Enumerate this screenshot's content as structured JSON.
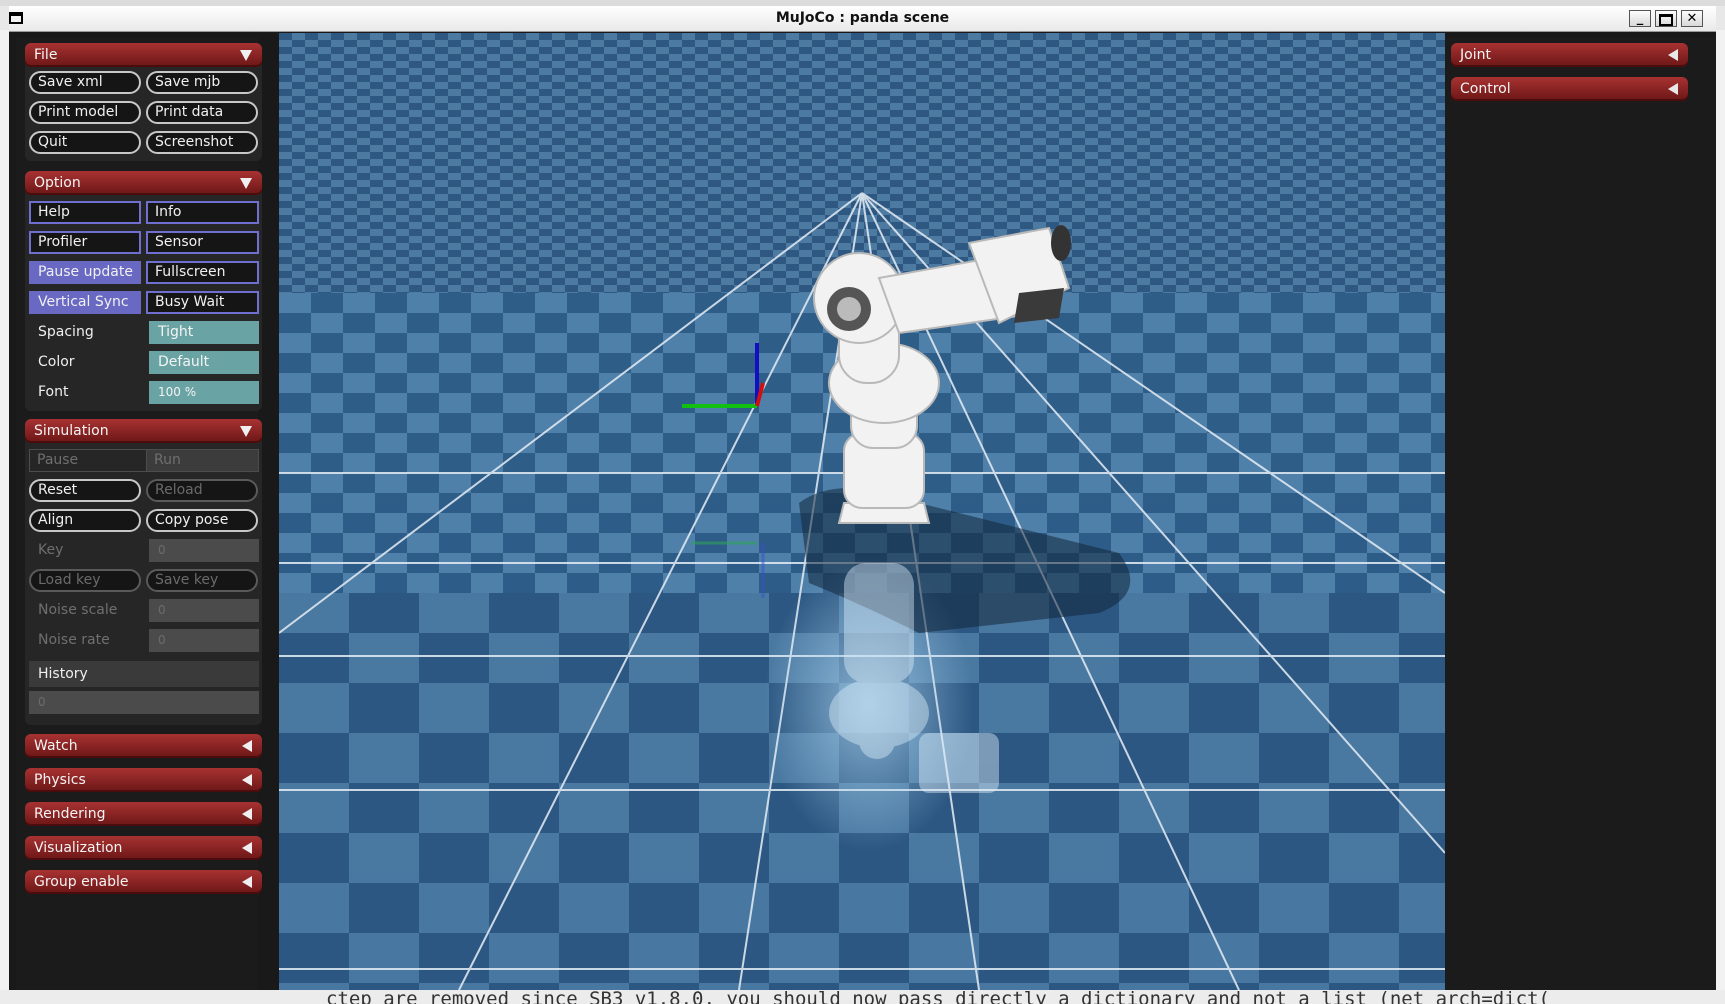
{
  "window": {
    "title": "MuJoCo : panda scene"
  },
  "terminal_bottom_text": "ctep are removed since SB3 v1.8.0, you should now pass directly a dictionary and not a list (net_arch=dict(",
  "left_panel": {
    "file": {
      "title": "File",
      "buttons": [
        "Save xml",
        "Save mjb",
        "Print model",
        "Print data",
        "Quit",
        "Screenshot"
      ]
    },
    "option": {
      "title": "Option",
      "toggles": [
        {
          "label": "Help",
          "on": false
        },
        {
          "label": "Info",
          "on": false
        },
        {
          "label": "Profiler",
          "on": false
        },
        {
          "label": "Sensor",
          "on": false
        },
        {
          "label": "Pause update",
          "on": true
        },
        {
          "label": "Fullscreen",
          "on": false
        },
        {
          "label": "Vertical Sync",
          "on": true
        },
        {
          "label": "Busy Wait",
          "on": false
        }
      ],
      "spacing_label": "Spacing",
      "spacing_value": "Tight",
      "color_label": "Color",
      "color_value": "Default",
      "font_label": "Font",
      "font_value": "100 %"
    },
    "simulation": {
      "title": "Simulation",
      "pause": "Pause",
      "run": "Run",
      "reset": "Reset",
      "reload": "Reload",
      "align": "Align",
      "copy_pose": "Copy pose",
      "key_label": "Key",
      "key_value": "0",
      "load_key": "Load key",
      "save_key": "Save key",
      "noise_scale_label": "Noise scale",
      "noise_scale_value": "0",
      "noise_rate_label": "Noise rate",
      "noise_rate_value": "0",
      "history_label": "History",
      "history_value": "0"
    },
    "collapsed": [
      "Watch",
      "Physics",
      "Rendering",
      "Visualization",
      "Group enable"
    ]
  },
  "right_panel": {
    "sections": [
      "Joint",
      "Control"
    ]
  },
  "colors": {
    "header_red": "#8e2424",
    "toggle_on": "#6969c4",
    "select_teal": "#6aa3a3",
    "floor_blue": "#2f5f86"
  }
}
